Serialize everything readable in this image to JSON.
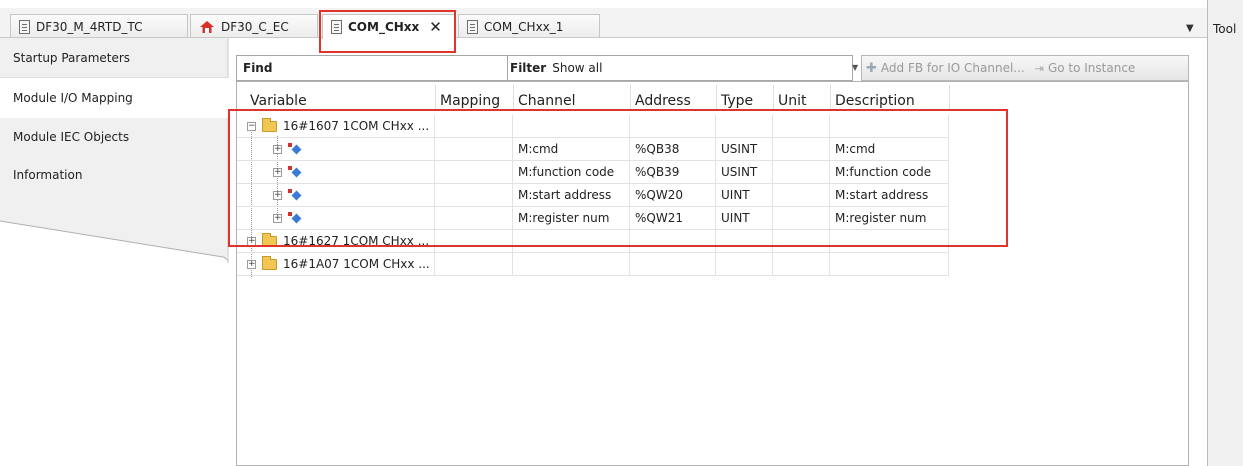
{
  "tabs": [
    {
      "label": "DF30_M_4RTD_TC",
      "icon": "device-icon"
    },
    {
      "label": "DF30_C_EC",
      "icon": "house-icon"
    },
    {
      "label": "COM_CHxx",
      "icon": "device-icon",
      "active": true,
      "close": "✕"
    },
    {
      "label": "COM_CHxx_1",
      "icon": "device-icon"
    }
  ],
  "tab_dropdown": "▼",
  "right_panel": {
    "label": "Tool"
  },
  "nav": {
    "items": [
      {
        "label": "Startup Parameters"
      },
      {
        "label": "Module I/O Mapping",
        "selected": true
      },
      {
        "label": "Module IEC Objects"
      },
      {
        "label": "Information"
      }
    ]
  },
  "toolbar": {
    "find_label": "Find",
    "filter_label": "Filter",
    "filter_value": "Show all",
    "filter_arrow": "▼",
    "add_fb_label": "Add FB for IO Channel...",
    "go_to_instance_label": "Go to Instance"
  },
  "grid": {
    "columns": [
      "Variable",
      "Mapping",
      "Channel",
      "Address",
      "Type",
      "Unit",
      "Description"
    ],
    "rows": [
      {
        "variable": "16#1607 1COM CHxx ...",
        "level": 0,
        "expanded": true,
        "channel": "",
        "address": "",
        "type": "",
        "unit": "",
        "description": ""
      },
      {
        "variable": "",
        "level": 1,
        "channel": "M:cmd",
        "address": "%QB38",
        "type": "USINT",
        "unit": "",
        "description": "M:cmd"
      },
      {
        "variable": "",
        "level": 1,
        "channel": "M:function code",
        "address": "%QB39",
        "type": "USINT",
        "unit": "",
        "description": "M:function code"
      },
      {
        "variable": "",
        "level": 1,
        "channel": "M:start address",
        "address": "%QW20",
        "type": "UINT",
        "unit": "",
        "description": "M:start address"
      },
      {
        "variable": "",
        "level": 1,
        "channel": "M:register num",
        "address": "%QW21",
        "type": "UINT",
        "unit": "",
        "description": "M:register num"
      },
      {
        "variable": "16#1627 1COM CHxx ...",
        "level": 0,
        "expanded": false,
        "channel": "",
        "address": "",
        "type": "",
        "unit": "",
        "description": ""
      },
      {
        "variable": "16#1A07 1COM CHxx ...",
        "level": 0,
        "expanded": false,
        "channel": "",
        "address": "",
        "type": "",
        "unit": "",
        "description": ""
      }
    ]
  },
  "symbols": {
    "collapsed": "+",
    "expanded": "−"
  },
  "colors": {
    "highlight": "#e0332b",
    "folder": "#f2c652"
  }
}
